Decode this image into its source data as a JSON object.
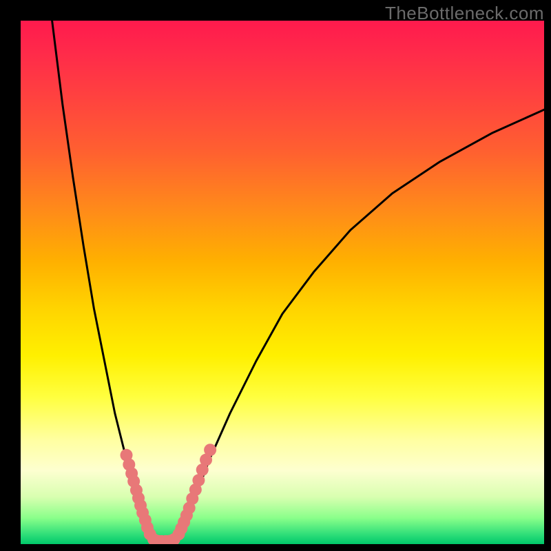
{
  "watermark": "TheBottleneck.com",
  "chart_data": {
    "type": "line",
    "title": "",
    "xlabel": "",
    "ylabel": "",
    "xlim": [
      0,
      100
    ],
    "ylim": [
      0,
      100
    ],
    "grid": false,
    "legend": false,
    "series": [
      {
        "name": "left-curve",
        "x": [
          6,
          8,
          10,
          12,
          14,
          16,
          18,
          20,
          22,
          23,
          24,
          24.7,
          25.2
        ],
        "y": [
          100,
          84,
          70,
          57,
          45,
          35,
          25,
          17,
          10,
          6,
          3.5,
          1.8,
          0.9
        ]
      },
      {
        "name": "valley-floor",
        "x": [
          25.2,
          26,
          27,
          28,
          29,
          29.8
        ],
        "y": [
          0.9,
          0.5,
          0.4,
          0.4,
          0.5,
          0.9
        ]
      },
      {
        "name": "right-curve",
        "x": [
          29.8,
          31,
          33,
          36,
          40,
          45,
          50,
          56,
          63,
          71,
          80,
          90,
          100
        ],
        "y": [
          0.9,
          3,
          8,
          16,
          25,
          35,
          44,
          52,
          60,
          67,
          73,
          78.5,
          83
        ]
      },
      {
        "name": "dots-left",
        "style": "scatter",
        "x": [
          20.2,
          20.7,
          21.2,
          21.6,
          22.1,
          22.5,
          22.9,
          23.3,
          23.8,
          24.2,
          24.7
        ],
        "y": [
          17.0,
          15.2,
          13.5,
          12.0,
          10.3,
          8.8,
          7.4,
          6.0,
          4.6,
          3.2,
          1.9
        ]
      },
      {
        "name": "dots-right",
        "style": "scatter",
        "x": [
          30.2,
          30.7,
          31.2,
          31.7,
          32.2,
          32.8,
          33.4,
          34.0,
          34.7,
          35.4,
          36.2
        ],
        "y": [
          1.9,
          3.0,
          4.2,
          5.5,
          6.9,
          8.7,
          10.4,
          12.2,
          14.2,
          16.1,
          18.0
        ]
      },
      {
        "name": "dots-floor",
        "style": "scatter",
        "x": [
          25.4,
          26.1,
          26.9,
          27.7,
          28.5,
          29.3
        ],
        "y": [
          0.9,
          0.6,
          0.55,
          0.55,
          0.6,
          0.9
        ]
      }
    ],
    "colors": {
      "curve": "#000000",
      "dots": "#e87878",
      "gradient_top": "#ff1a4d",
      "gradient_bottom": "#00c86a"
    }
  }
}
